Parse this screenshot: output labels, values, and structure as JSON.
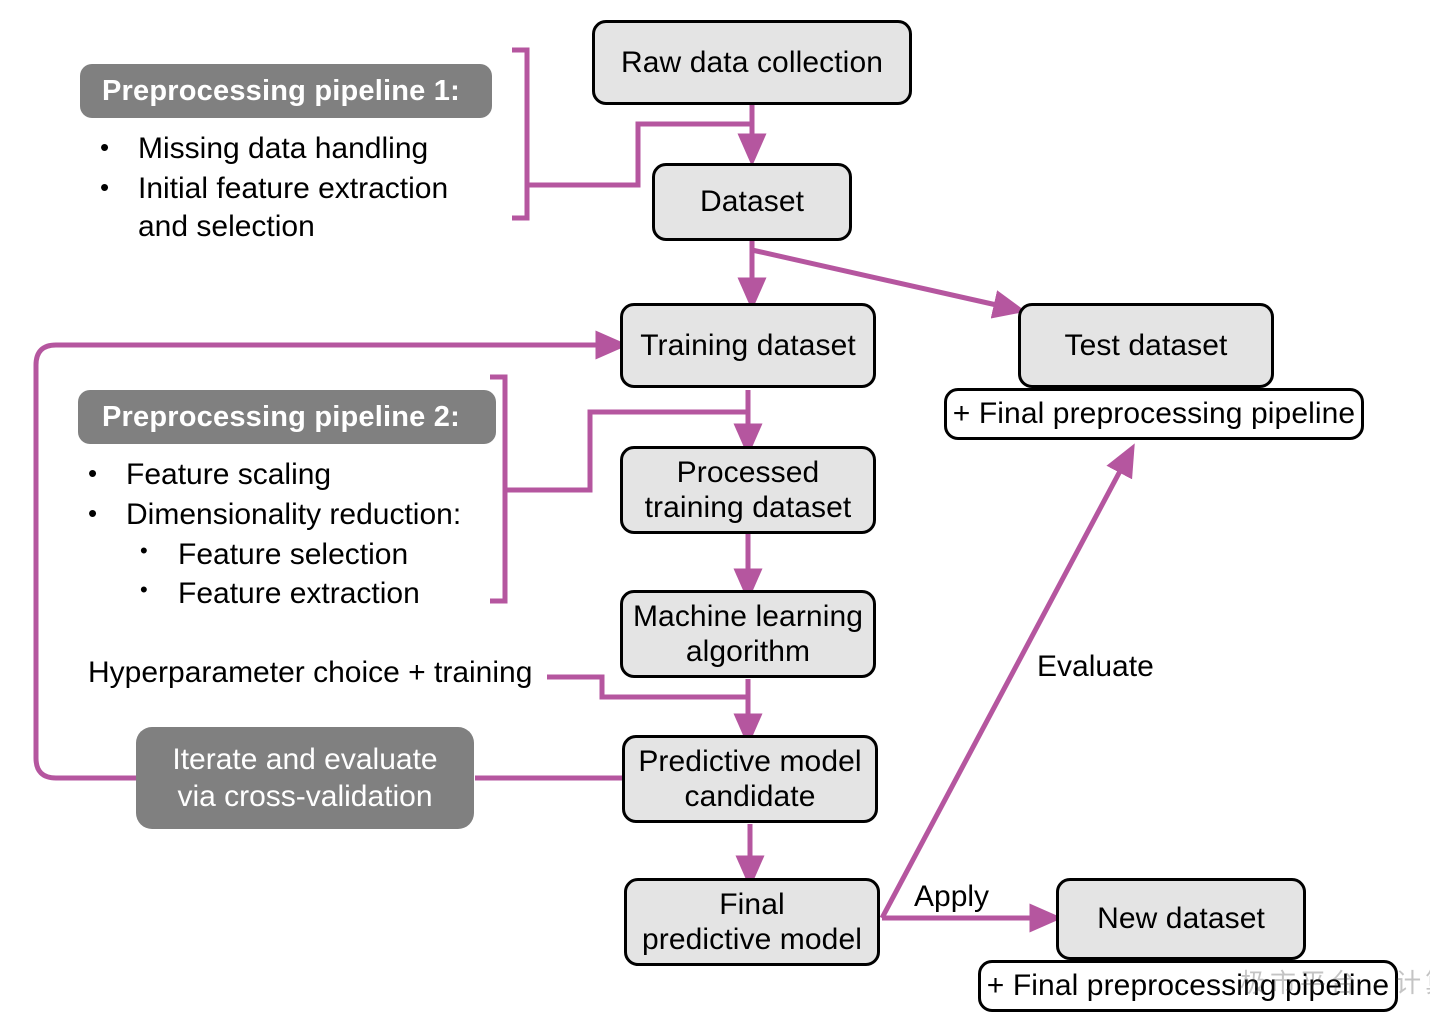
{
  "meta": {
    "title": "Machine learning predictive modeling workflow",
    "accent_color": "#b5569f",
    "gray_color": "#808080",
    "node_fill": "#e4e4e4",
    "node_border": "#000000",
    "background": "#ffffff"
  },
  "nodes": {
    "raw_data": "Raw data collection",
    "dataset": "Dataset",
    "training_dataset": "Training dataset",
    "test_dataset": "Test dataset",
    "test_pipeline_note": "+ Final preprocessing pipeline",
    "processed_training": "Processed\ntraining dataset",
    "ml_algorithm": "Machine learning\nalgorithm",
    "predictive_model_candidate": "Predictive model\ncandidate",
    "final_predictive_model": "Final\npredictive model",
    "new_dataset": "New dataset",
    "new_pipeline_note": "+ Final preprocessing pipeline"
  },
  "pipeline1": {
    "header": "Preprocessing  pipeline 1:",
    "items": [
      "Missing data handling",
      "Initial feature extraction and selection"
    ]
  },
  "pipeline2": {
    "header": "Preprocessing pipeline 2:",
    "items": [
      {
        "text": "Feature scaling",
        "level": 1
      },
      {
        "text": "Dimensionality reduction:",
        "level": 1
      },
      {
        "text": "Feature selection",
        "level": 2
      },
      {
        "text": "Feature extraction",
        "level": 2
      }
    ]
  },
  "labels": {
    "hyperparameter": "Hyperparameter choice + training",
    "iterate": "Iterate and evaluate\nvia cross-validation",
    "evaluate": "Evaluate",
    "apply": "Apply",
    "bullet_glyph": "•"
  },
  "watermark": {
    "text": "极市平台 · 计算机视觉社区"
  }
}
